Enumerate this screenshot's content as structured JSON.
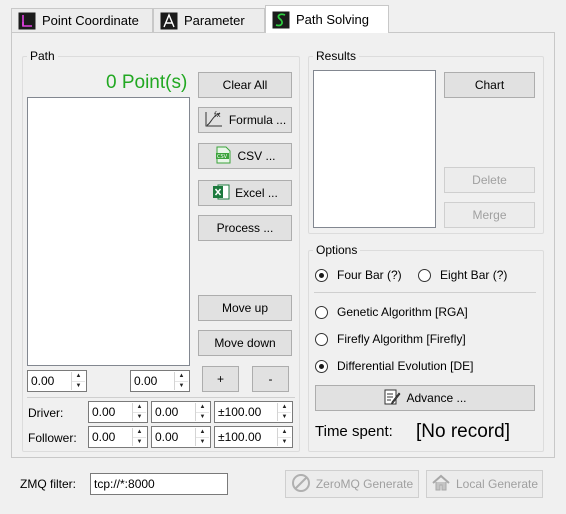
{
  "tabs": [
    {
      "label": "Point Coordinate",
      "icon": "point-coordinate-icon"
    },
    {
      "label": "Parameter",
      "icon": "parameter-icon"
    },
    {
      "label": "Path Solving",
      "icon": "path-solving-icon",
      "active": true
    }
  ],
  "path": {
    "title": "Path",
    "point_count": "0 Point(s)",
    "point_count_color": "#22a822",
    "buttons": {
      "clear_all": "Clear All",
      "formula": "Formula ...",
      "csv": "CSV ...",
      "excel": "Excel ...",
      "process": "Process ...",
      "move_up": "Move up",
      "move_down": "Move down",
      "plus": "+",
      "minus": "-"
    },
    "x_value": "0.00",
    "y_value": "0.00",
    "driver_label": "Driver:",
    "follower_label": "Follower:",
    "driver": [
      "0.00",
      "0.00",
      "±100.00"
    ],
    "follower": [
      "0.00",
      "0.00",
      "±100.00"
    ]
  },
  "results": {
    "title": "Results",
    "buttons": {
      "chart": "Chart",
      "delete": "Delete",
      "merge": "Merge"
    }
  },
  "options": {
    "title": "Options",
    "linkage": [
      {
        "label": "Four Bar (?)",
        "checked": true
      },
      {
        "label": "Eight Bar (?)",
        "checked": false
      }
    ],
    "algorithms": [
      {
        "label": "Genetic Algorithm [RGA]",
        "checked": false
      },
      {
        "label": "Firefly Algorithm [Firefly]",
        "checked": false
      },
      {
        "label": "Differential Evolution [DE]",
        "checked": true
      }
    ],
    "advance": "Advance ...",
    "time_label": "Time spent:",
    "time_value": "[No record]"
  },
  "footer": {
    "zmq_label": "ZMQ filter:",
    "zmq_value": "tcp://*:8000",
    "zeromq_generate": "ZeroMQ Generate",
    "local_generate": "Local Generate"
  }
}
